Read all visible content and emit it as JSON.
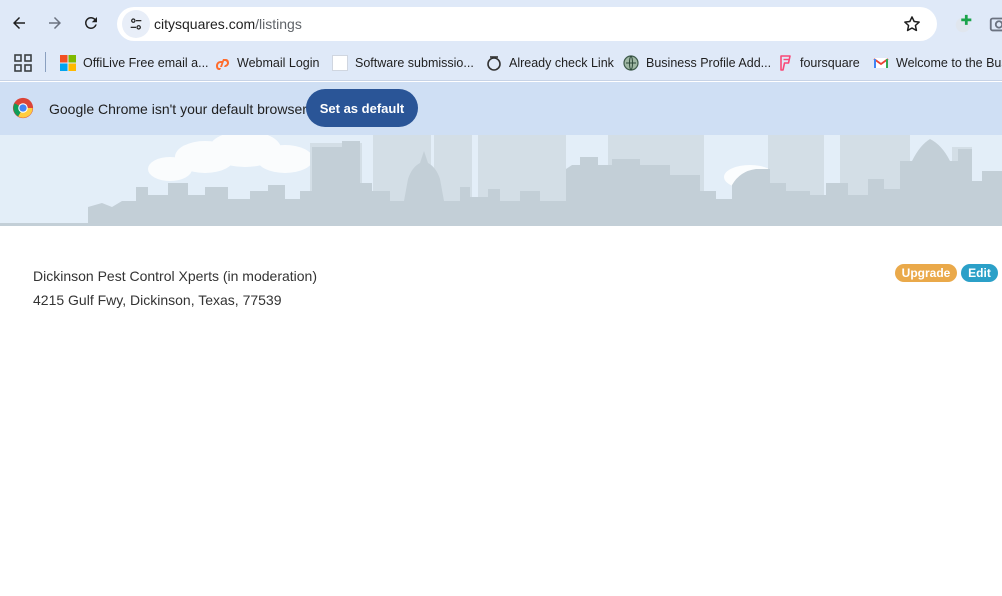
{
  "browser": {
    "url_domain": "citysquares.com",
    "url_path": "/listings"
  },
  "bookmarks": [
    {
      "label": "OffiLive Free email a...",
      "icon": "microsoft-squares-icon"
    },
    {
      "label": "Webmail Login",
      "icon": "cpanel-icon"
    },
    {
      "label": "Software submissio...",
      "icon": "blank-page-icon"
    },
    {
      "label": "Already check Link",
      "icon": "circle-icon"
    },
    {
      "label": "Business Profile Add...",
      "icon": "globe-icon"
    },
    {
      "label": "foursquare",
      "icon": "foursquare-icon"
    },
    {
      "label": "Welcome to the Bus",
      "icon": "gmail-icon"
    }
  ],
  "infobar": {
    "message": "Google Chrome isn't your default browser",
    "button_label": "Set as default"
  },
  "listing": {
    "name": "Dickinson Pest Control Xperts (in moderation)",
    "address": "4215 Gulf Fwy, Dickinson, Texas, 77539",
    "upgrade_label": "Upgrade",
    "edit_label": "Edit"
  },
  "colors": {
    "chrome_frame": "#dfe9f8",
    "infobar_bg": "#cfdff4",
    "set_default_button": "#2a5597",
    "upgrade_badge": "#eaa94a",
    "edit_badge": "#2ba0c8"
  }
}
